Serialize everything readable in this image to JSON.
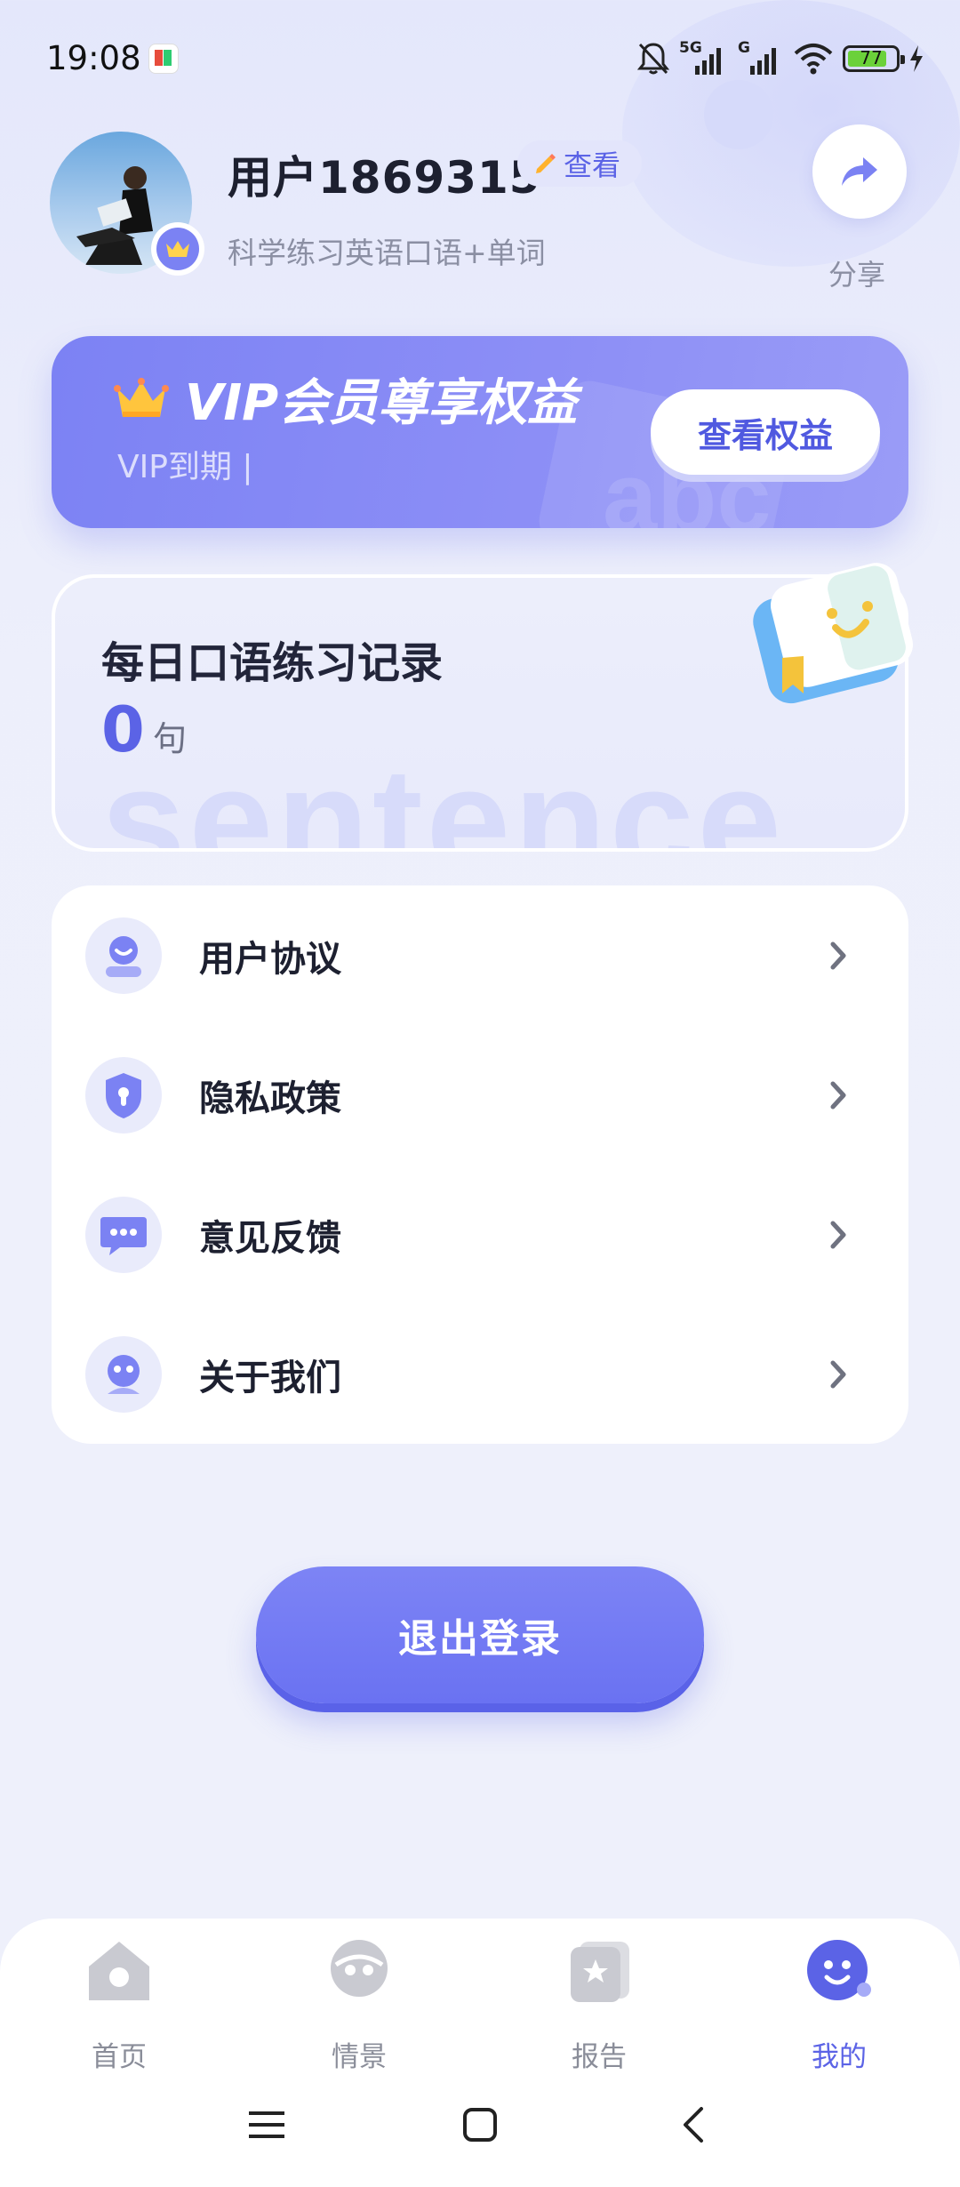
{
  "status_bar": {
    "time": "19:08",
    "network_1": "5G",
    "network_2": "G",
    "battery": "77"
  },
  "profile": {
    "username": "用户1869315",
    "view_label": "查看",
    "subtitle": "科学练习英语口语+单词",
    "share_label": "分享"
  },
  "vip": {
    "title": "VIP会员尊享权益",
    "expire_label": "VIP到期 |",
    "button_label": "查看权益",
    "watermark": "abc"
  },
  "record": {
    "title": "每日口语练习记录",
    "count": "0",
    "unit": "句",
    "watermark": "sentence"
  },
  "menu": {
    "items": [
      {
        "label": "用户协议",
        "icon": "user-agreement-icon"
      },
      {
        "label": "隐私政策",
        "icon": "privacy-shield-icon"
      },
      {
        "label": "意见反馈",
        "icon": "feedback-chat-icon"
      },
      {
        "label": "关于我们",
        "icon": "about-us-icon"
      }
    ]
  },
  "logout": {
    "label": "退出登录"
  },
  "tabs": [
    {
      "label": "首页",
      "icon": "home-icon",
      "active": false
    },
    {
      "label": "情景",
      "icon": "scene-icon",
      "active": false
    },
    {
      "label": "报告",
      "icon": "report-icon",
      "active": false
    },
    {
      "label": "我的",
      "icon": "profile-icon",
      "active": true
    }
  ],
  "colors": {
    "accent": "#5b63e6",
    "vip_gradient_start": "#7c82f4",
    "battery_fill": "#6bd13a"
  }
}
